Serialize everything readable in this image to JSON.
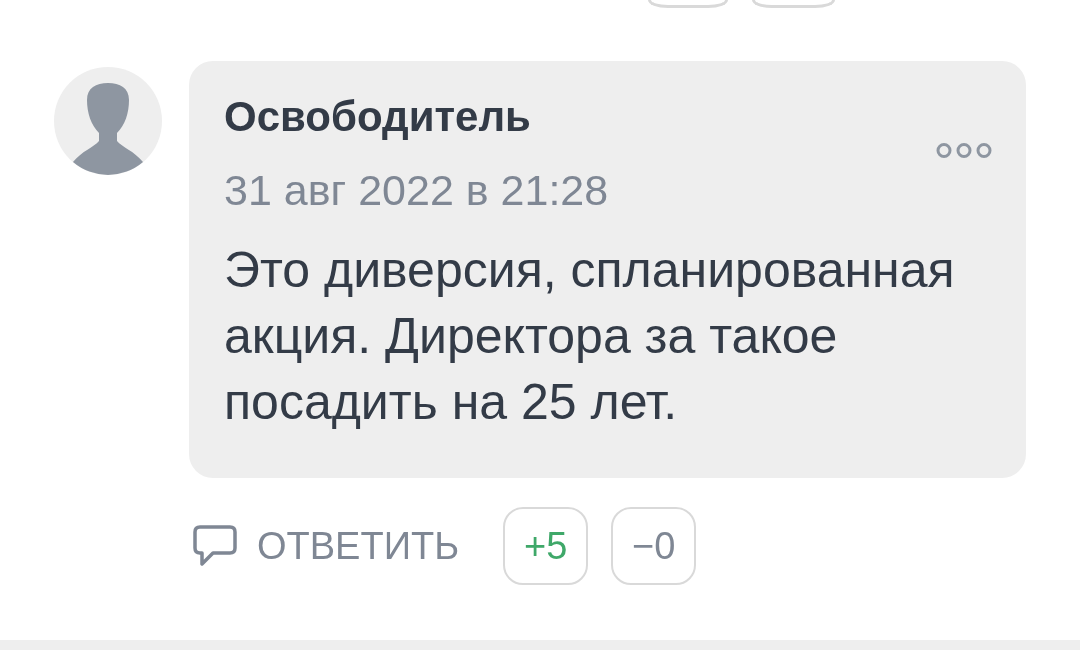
{
  "previous_comment": {
    "vote_buttons": [
      {
        "kind": "up"
      },
      {
        "kind": "down"
      }
    ]
  },
  "comment": {
    "author": "Освободитель",
    "date": "31 авг 2022 в 21:28",
    "text": "Это диверсия, спланированная акция. Директора за такое посадить на 25 лет.",
    "reply_label": "ОТВЕТИТЬ",
    "votes": [
      {
        "kind": "up",
        "label": "+5"
      },
      {
        "kind": "down",
        "label": "−0"
      }
    ]
  }
}
